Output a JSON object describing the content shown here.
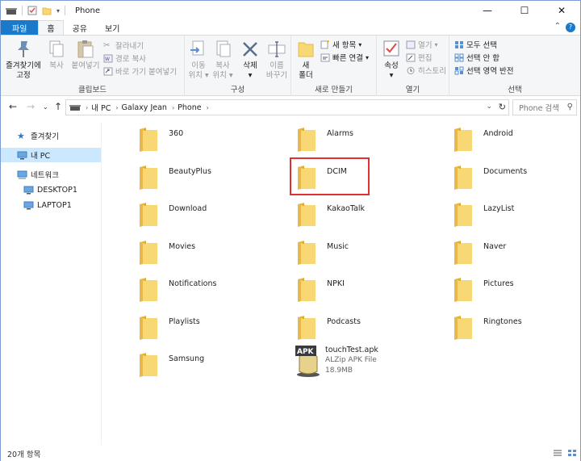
{
  "window": {
    "title": "Phone",
    "controls": {
      "minimize": "—",
      "maximize": "☐",
      "close": "✕"
    }
  },
  "ribbon_tabs": [
    {
      "label": "파일"
    },
    {
      "label": "홈"
    },
    {
      "label": "공유"
    },
    {
      "label": "보기"
    }
  ],
  "ribbon": {
    "clipboard": {
      "label": "클립보드",
      "pin": "즐겨찾기에",
      "pin2": "고정",
      "copy": "복사",
      "paste": "붙여넣기",
      "cut": "잘라내기",
      "copy_path": "경로 복사",
      "paste_shortcut": "바로 가기 붙여넣기"
    },
    "organize": {
      "label": "구성",
      "move1": "이동",
      "move2": "위치",
      "copyto1": "복사",
      "copyto2": "위치",
      "delete": "삭제",
      "rename1": "이름",
      "rename2": "바꾸기"
    },
    "new": {
      "label": "새로 만들기",
      "folder1": "새",
      "folder2": "폴더",
      "new_item": "새 항목",
      "easy_access": "빠른 연결"
    },
    "open": {
      "label": "열기",
      "properties": "속성",
      "open": "열기",
      "edit": "편집",
      "history": "히스토리"
    },
    "select": {
      "label": "선택",
      "all": "모두 선택",
      "none": "선택 안 함",
      "invert": "선택 영역 반전"
    }
  },
  "address": {
    "crumbs": [
      "내 PC",
      "Galaxy Jean",
      "Phone"
    ],
    "search_placeholder": "Phone 검색"
  },
  "nav": [
    {
      "label": "즐겨찾기",
      "icon": "star-icon"
    },
    {
      "label": "내 PC",
      "icon": "computer-icon",
      "selected": true
    },
    {
      "label": "네트워크",
      "icon": "network-icon"
    },
    {
      "label": "DESKTOP1",
      "icon": "computer-icon"
    },
    {
      "label": "LAPTOP1",
      "icon": "computer-icon"
    }
  ],
  "items": [
    {
      "name": "360"
    },
    {
      "name": "Alarms"
    },
    {
      "name": "Android"
    },
    {
      "name": "BeautyPlus"
    },
    {
      "name": "DCIM"
    },
    {
      "name": "Documents"
    },
    {
      "name": "Download"
    },
    {
      "name": "KakaoTalk"
    },
    {
      "name": "LazyList"
    },
    {
      "name": "Movies"
    },
    {
      "name": "Music"
    },
    {
      "name": "Naver"
    },
    {
      "name": "Notifications"
    },
    {
      "name": "NPKI"
    },
    {
      "name": "Pictures"
    },
    {
      "name": "Playlists"
    },
    {
      "name": "Podcasts"
    },
    {
      "name": "Ringtones"
    },
    {
      "name": "Samsung"
    },
    {
      "name": "touchTest.apk",
      "type": "ALZip APK File",
      "size": "18.9MB",
      "badge": "APK"
    }
  ],
  "status": {
    "count": "20개 항목"
  },
  "colors": {
    "accent": "#1979ca",
    "folder": "#f8d775",
    "folder_dark": "#e8b84a",
    "selection": "#cce8ff",
    "highlight": "#e03131"
  }
}
